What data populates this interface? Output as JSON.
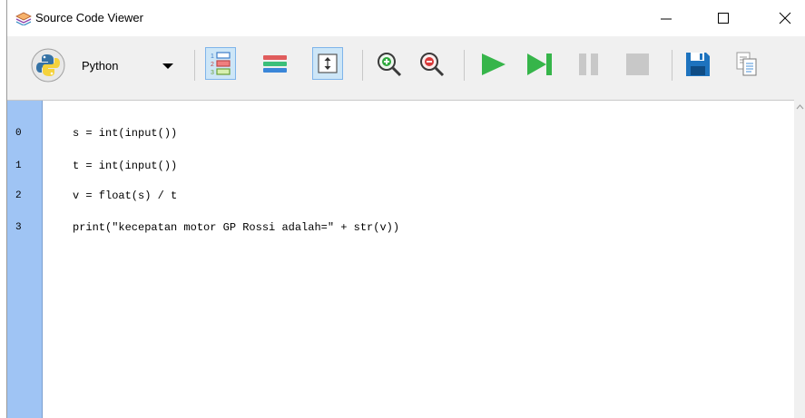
{
  "window": {
    "title": "Source Code Viewer"
  },
  "toolbar": {
    "language": {
      "selected": "Python"
    },
    "buttons": [
      {
        "icon": "line-numbers-icon",
        "toggled": true
      },
      {
        "icon": "highlight-lines-icon",
        "toggled": false
      },
      {
        "icon": "fit-view-icon",
        "toggled": true
      },
      {
        "icon": "zoom-in-icon"
      },
      {
        "icon": "zoom-out-icon"
      },
      {
        "icon": "run-icon"
      },
      {
        "icon": "step-icon"
      },
      {
        "icon": "pause-icon"
      },
      {
        "icon": "stop-icon"
      },
      {
        "icon": "save-icon"
      },
      {
        "icon": "copy-icon"
      }
    ]
  },
  "editor": {
    "lines": [
      {
        "number": "0",
        "code": "s = int(input())"
      },
      {
        "number": "1",
        "code": "t = int(input())"
      },
      {
        "number": "2",
        "code": "v = float(s) / t"
      },
      {
        "number": "3",
        "code": "print(\"kecepatan motor GP Rossi adalah=\" + str(v))"
      }
    ]
  },
  "colors": {
    "gutter": "#9fc4f4",
    "run": "#36b54a",
    "disabled": "#c8c8c8",
    "save": "#1e73be"
  }
}
